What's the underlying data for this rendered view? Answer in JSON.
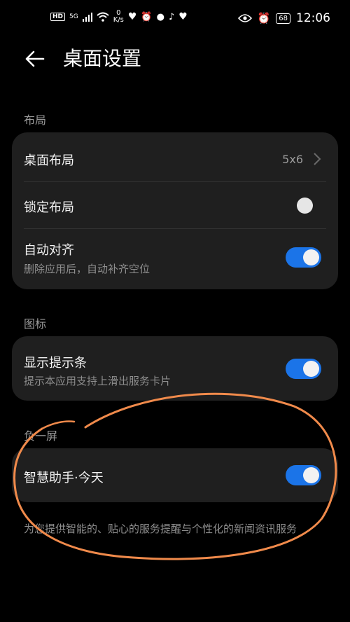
{
  "status_bar": {
    "hd": "HD",
    "signal": "5G",
    "speed_value": "0",
    "speed_unit": "K/s",
    "battery": "68",
    "time": "12:06"
  },
  "header": {
    "title": "桌面设置"
  },
  "sections": {
    "layout": {
      "label": "布局",
      "desktop_layout": {
        "title": "桌面布局",
        "value": "5x6"
      },
      "lock_layout": {
        "title": "锁定布局",
        "enabled": false
      },
      "auto_align": {
        "title": "自动对齐",
        "subtitle": "删除应用后，自动补齐空位",
        "enabled": true
      }
    },
    "icons": {
      "label": "图标",
      "show_hint": {
        "title": "显示提示条",
        "subtitle": "提示本应用支持上滑出服务卡片",
        "enabled": true
      }
    },
    "minus_one": {
      "label": "负一屏",
      "assistant": {
        "title": "智慧助手·今天",
        "enabled": true
      },
      "footer": "为您提供智能的、贴心的服务提醒与个性化的新闻资讯服务"
    }
  },
  "colors": {
    "accent": "#1b74e8",
    "annotation": "#f08a4b",
    "card": "#1f1f1f"
  }
}
